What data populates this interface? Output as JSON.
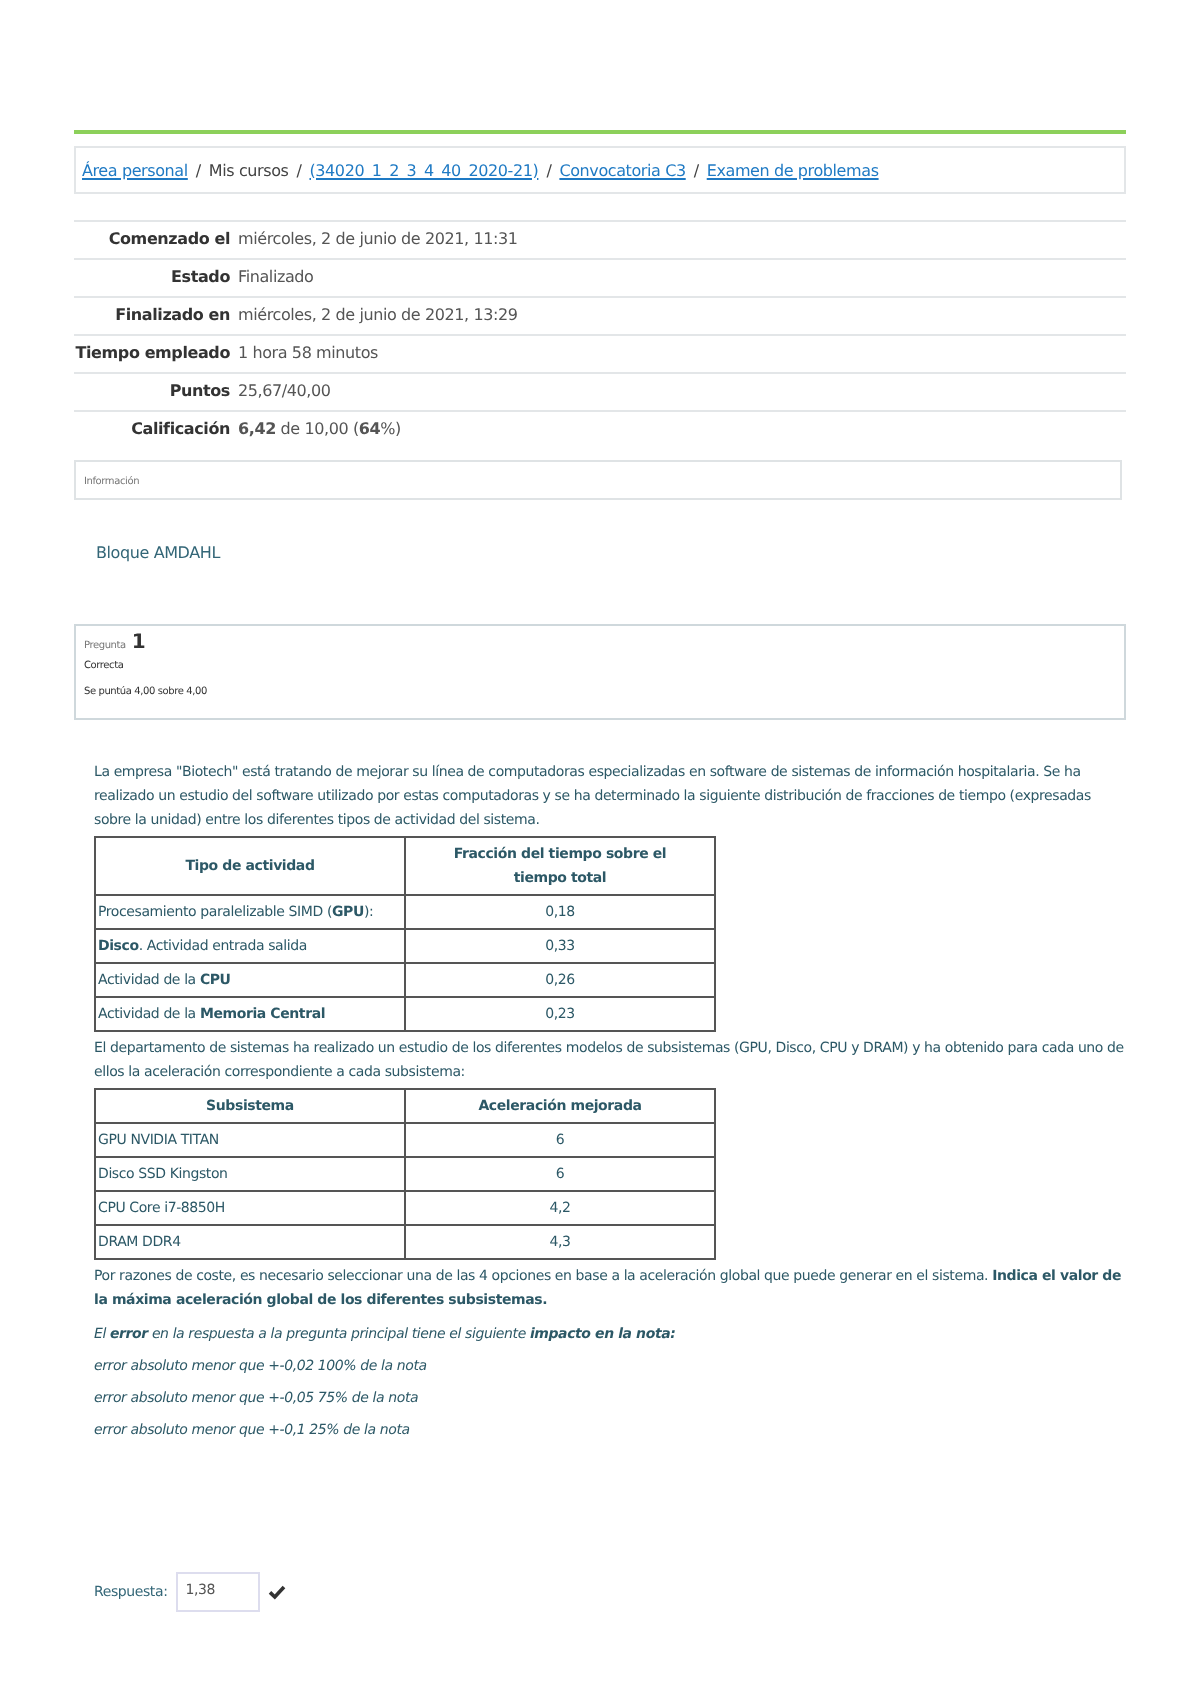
{
  "breadcrumb_separator": "/",
  "breadcrumb": [
    {
      "label": "Área personal",
      "kind": "link"
    },
    {
      "label": "Mis cursos",
      "kind": "text"
    },
    {
      "label": "(34020_1_2_3_4_40_2020-21)",
      "kind": "link"
    },
    {
      "label": "Convocatoria C3",
      "kind": "link"
    },
    {
      "label": "Examen de problemas",
      "kind": "link"
    }
  ],
  "summary": [
    {
      "label": "Comenzado el",
      "value": "miércoles, 2 de junio de 2021, 11:31"
    },
    {
      "label": "Estado",
      "value": "Finalizado"
    },
    {
      "label": "Finalizado en",
      "value": "miércoles, 2 de junio de 2021, 13:29"
    },
    {
      "label": "Tiempo empleado",
      "value": "1 hora 58 minutos"
    },
    {
      "label": "Puntos",
      "value": "25,67/40,00"
    },
    {
      "label": "Calificación",
      "value": "**6,42** de 10,00 (**64**%)"
    }
  ],
  "info_box": {
    "title": "Información",
    "text": "Bloque AMDAHL"
  },
  "question": {
    "label": "Pregunta",
    "number": "1",
    "status": "Correcta",
    "score": "Se puntúa 4,00 sobre 4,00"
  },
  "intro": "La empresa \"Biotech\" está tratando de mejorar su línea de computadoras especializadas en software de sistemas de información hospitalaria. Se ha realizado un estudio del software utilizado por estas computadoras y se ha determinado la siguiente distribución de fracciones de tiempo (expresadas sobre la unidad) entre los diferentes tipos de actividad del sistema.",
  "table_1": {
    "columns": [
      "Tipo de actividad",
      "Fracción del tiempo sobre el tiempo total"
    ],
    "rows": [
      [
        "Procesamiento paralelizable SIMD (**GPU**):",
        "0,18"
      ],
      [
        "**Disco**. Actividad entrada salida",
        "0,33"
      ],
      [
        "Actividad de la **CPU**",
        "0,26"
      ],
      [
        "Actividad de la **Memoria Central**",
        "0,23"
      ]
    ]
  },
  "middle": "El departamento de sistemas ha realizado un estudio de los diferentes modelos de subsistemas (GPU, Disco, CPU y DRAM) y ha obtenido para cada uno de ellos la aceleración correspondiente a cada subsistema:",
  "table_2": {
    "columns": [
      "Subsistema",
      "Aceleración mejorada"
    ],
    "rows": [
      [
        "GPU NVIDIA TITAN",
        "6"
      ],
      [
        "Disco SSD Kingston",
        "6"
      ],
      [
        "CPU Core i7-8850H",
        "4,2"
      ],
      [
        "DRAM DDR4",
        "4,3"
      ]
    ]
  },
  "task": "Por razones de coste, es necesario seleccionar una de las 4 opciones en base a la aceleración global que puede generar en el sistema. **Indica el valor de la máxima aceleración global de los diferentes subsistemas.**",
  "notes": [
    "El **error** en la respuesta a la pregunta principal tiene el siguiente **impacto en la nota:**",
    "error absoluto menor que +-0,02  100% de la nota",
    "error absoluto menor que +-0,05  75% de la nota",
    "error absoluto menor que +-0,1 25% de la nota"
  ],
  "answer": {
    "label": "Respuesta:",
    "value": "1,38",
    "correct": true
  }
}
